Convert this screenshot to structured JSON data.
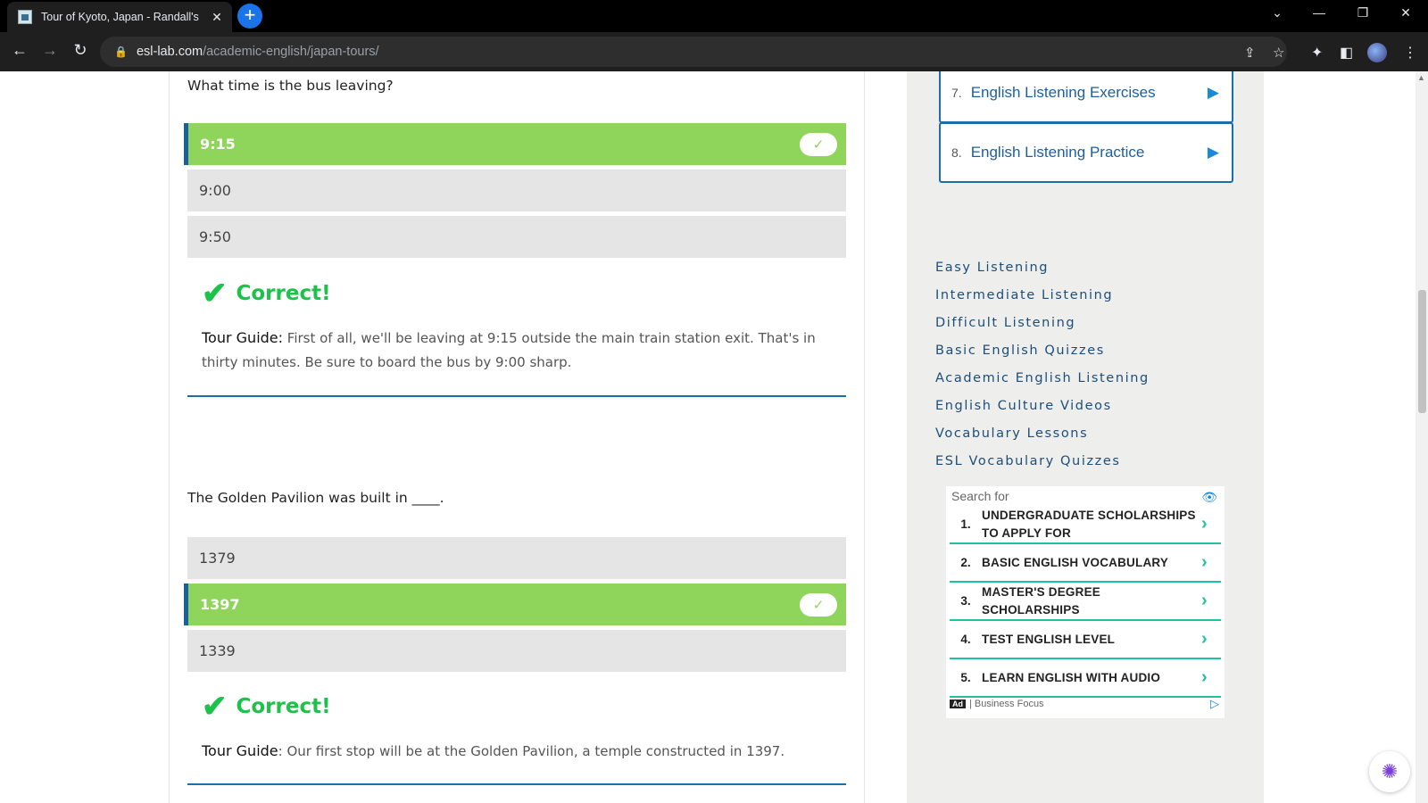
{
  "browser": {
    "tab_title": "Tour of Kyoto, Japan - Randall's",
    "tab_close": "✕",
    "new_tab": "+",
    "url_host": "esl-lab.com",
    "url_path": "/academic-english/japan-tours/"
  },
  "quiz": [
    {
      "question": "What time is the bus leaving?",
      "answers": [
        {
          "label": "9:15",
          "correct": true
        },
        {
          "label": "9:00",
          "correct": false
        },
        {
          "label": "9:50",
          "correct": false
        }
      ],
      "feedback": "Correct!",
      "speaker": "Tour Guide:",
      "explanation": " First of all, we'll be leaving at 9:15 outside the main train station exit. That's in thirty minutes. Be sure to board the bus by 9:00 sharp."
    },
    {
      "question": "The Golden Pavilion was built in ____.",
      "answers": [
        {
          "label": "1379",
          "correct": false
        },
        {
          "label": "1397",
          "correct": true
        },
        {
          "label": "1339",
          "correct": false
        }
      ],
      "feedback": "Correct!",
      "speaker": "Tour Guide",
      "explanation": ": Our first stop will be at the Golden Pavilion, a temple constructed in 1397."
    }
  ],
  "sidebar": {
    "cards": [
      {
        "num": "7.",
        "label": "English Listening Exercises"
      },
      {
        "num": "8.",
        "label": "English Listening Practice"
      }
    ],
    "links": [
      "Easy Listening",
      "Intermediate Listening",
      "Difficult Listening",
      "Basic English Quizzes",
      "Academic English Listening",
      "English Culture Videos",
      "Vocabulary Lessons",
      "ESL Vocabulary Quizzes"
    ],
    "ad": {
      "search_for": "Search for",
      "items": [
        {
          "num": "1.",
          "label": "UNDERGRADUATE SCHOLARSHIPS TO APPLY FOR"
        },
        {
          "num": "2.",
          "label": "BASIC ENGLISH VOCABULARY"
        },
        {
          "num": "3.",
          "label": "MASTER'S DEGREE SCHOLARSHIPS"
        },
        {
          "num": "4.",
          "label": "TEST ENGLISH LEVEL"
        },
        {
          "num": "5.",
          "label": "LEARN ENGLISH WITH AUDIO"
        }
      ],
      "badge": "Ad",
      "sponsor": "| Business Focus"
    }
  },
  "colors": {
    "correct_green": "#8fd45b",
    "check_green": "#1ec24b",
    "accent_blue": "#1c6ea4"
  }
}
